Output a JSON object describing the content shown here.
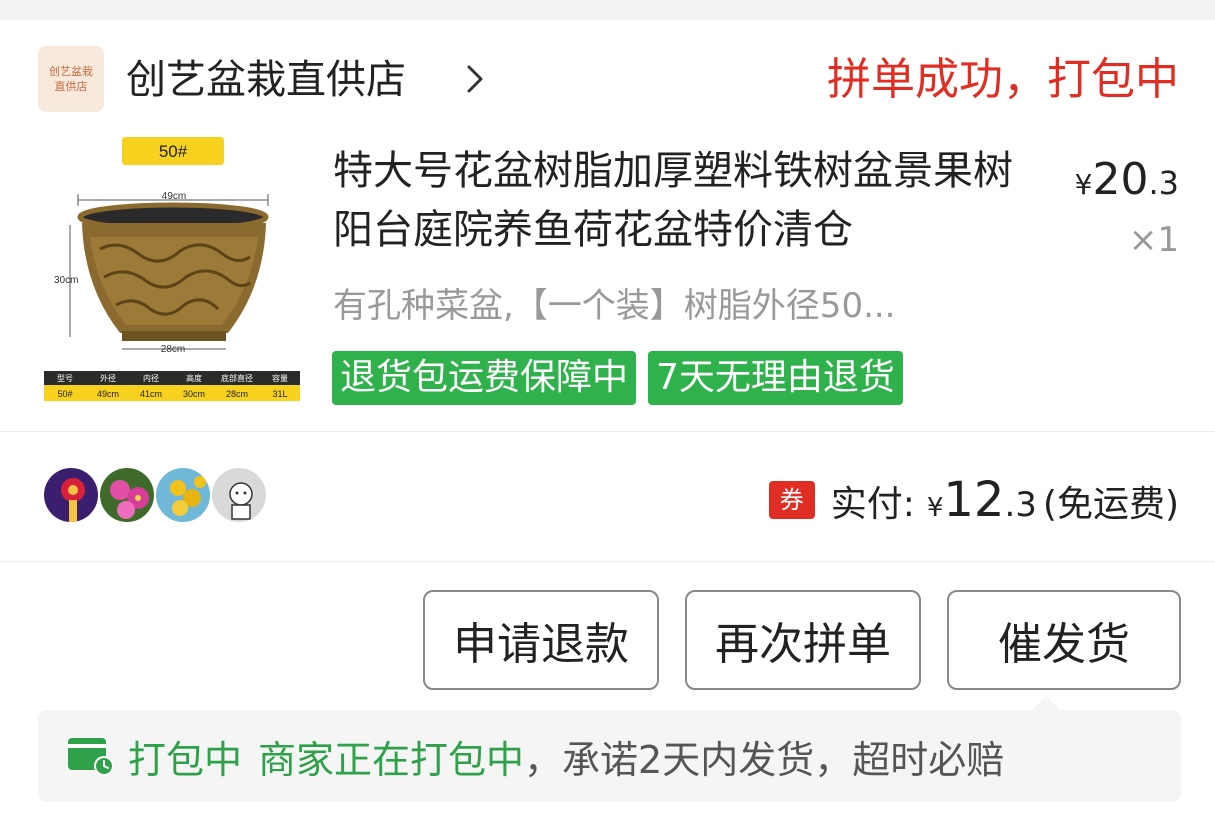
{
  "shop": {
    "logo_line1": "创艺盆栽",
    "logo_line2": "直供店",
    "name": "创艺盆栽直供店",
    "arrow_icon": "chevron-right-icon"
  },
  "order": {
    "status": "拼单成功，打包中"
  },
  "product": {
    "image": {
      "size_badge": "50#",
      "dim_outer": "49cm",
      "dim_inner": "41cm",
      "dim_height": "30cm",
      "dim_bottom": "28cm",
      "table_headers": [
        "型号",
        "外径",
        "内径",
        "高度",
        "底部直径",
        "容量"
      ],
      "table_values": [
        "50#",
        "49cm",
        "41cm",
        "30cm",
        "28cm",
        "31L"
      ]
    },
    "title": "特大号花盆树脂加厚塑料铁树盆景果树阳台庭院养鱼荷花盆特价清仓",
    "spec": "有孔种菜盆,【一个装】树脂外径50...",
    "price_symbol": "¥",
    "price_int": "20",
    "price_dec": ".3",
    "quantity": "×1",
    "tags": [
      "退货包运费保障中",
      "7天无理由退货"
    ]
  },
  "group": {
    "avatar_count": 4
  },
  "payment": {
    "coupon_badge": "券",
    "label": "实付:",
    "symbol": "¥",
    "amount_int": "12",
    "amount_dec": ".3",
    "note": "(免运费)"
  },
  "actions": {
    "refund": "申请退款",
    "regroup": "再次拼单",
    "urge": "催发货"
  },
  "notice": {
    "icon": "truck-clock-icon",
    "status": "打包中",
    "highlight": "商家正在打包中",
    "rest": "，承诺2天内发货，超时必赔"
  },
  "colors": {
    "accent_red": "#e02e24",
    "accent_green": "#2fb24c",
    "notice_green": "#2fa14a"
  }
}
